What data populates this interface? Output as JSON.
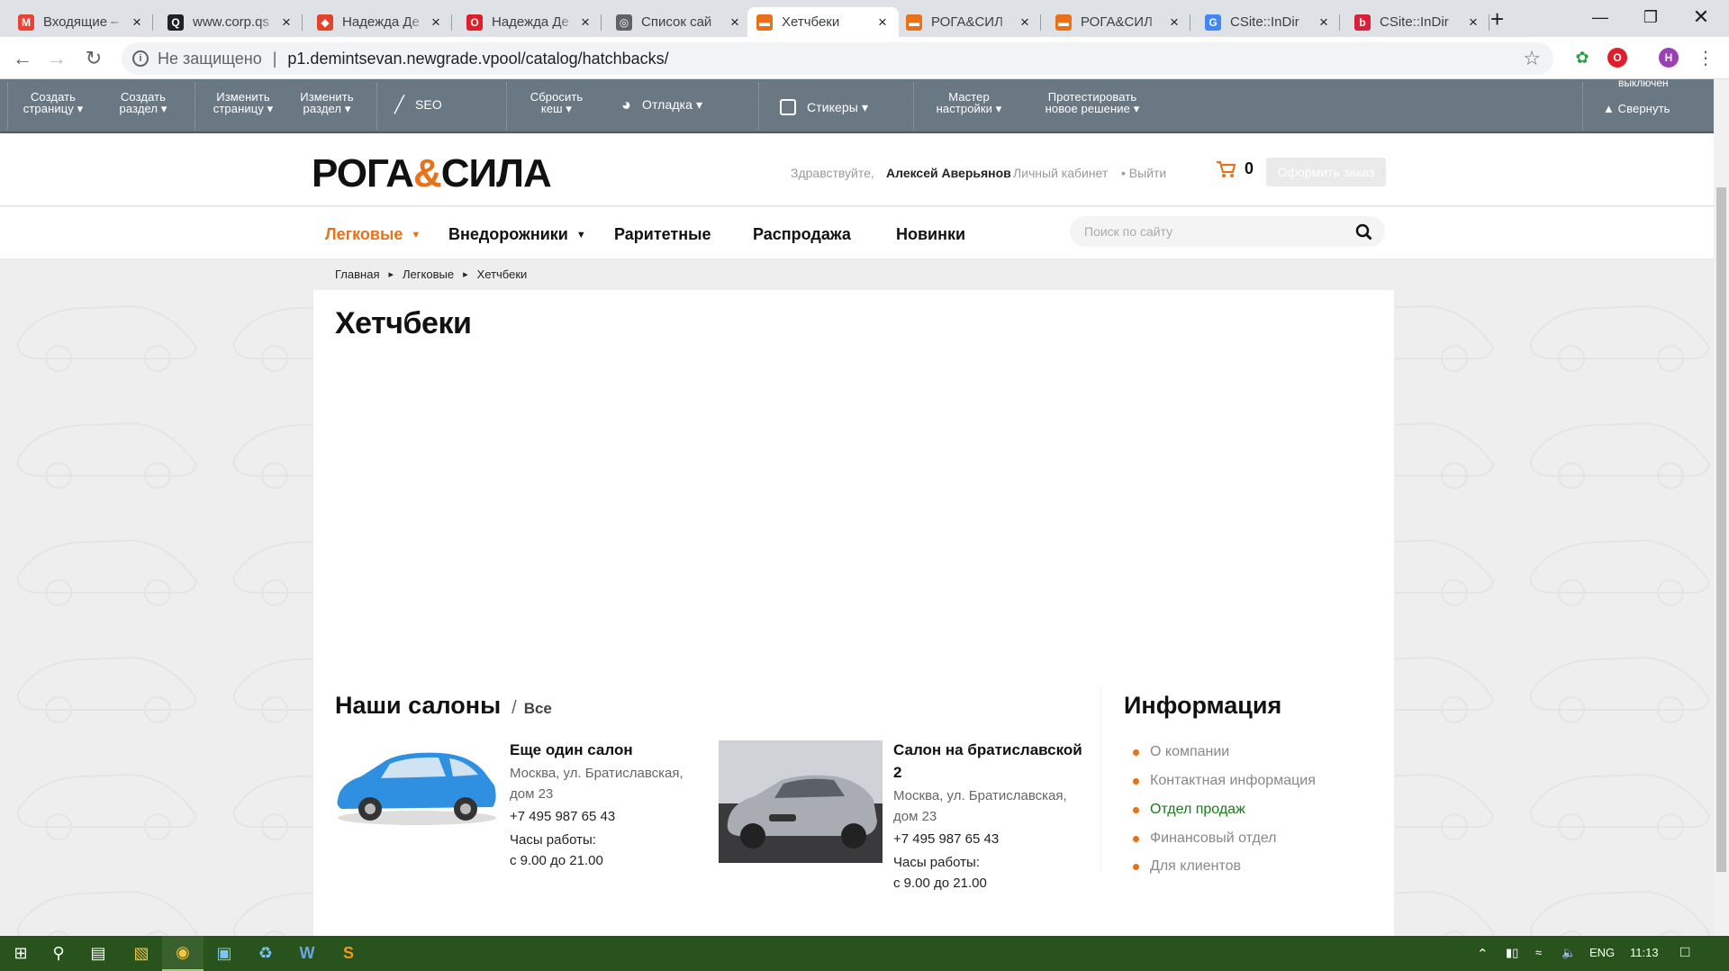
{
  "browser": {
    "tabs": [
      {
        "title": "Входящие – ",
        "favicon": "gmail-icon",
        "color": "#ea4335",
        "glyph": "M",
        "active": false
      },
      {
        "title": "www.corp.qs",
        "favicon": "quora-icon",
        "color": "#202124",
        "glyph": "Q",
        "active": false
      },
      {
        "title": "Надежда Де",
        "favicon": "gitlab-icon",
        "color": "#e24329",
        "glyph": "◆",
        "active": false
      },
      {
        "title": "Надежда Де",
        "favicon": "opera-icon",
        "color": "#e01e2b",
        "glyph": "O",
        "active": false
      },
      {
        "title": "Список сай",
        "favicon": "globe-icon",
        "color": "#5f6368",
        "glyph": "◎",
        "active": false
      },
      {
        "title": "Хетчбеки",
        "favicon": "car-icon",
        "color": "#e8711a",
        "glyph": "▬",
        "active": true
      },
      {
        "title": "РОГА&СИЛ",
        "favicon": "car-icon",
        "color": "#e8711a",
        "glyph": "▬",
        "active": false
      },
      {
        "title": "РОГА&СИЛ",
        "favicon": "car-icon",
        "color": "#e8711a",
        "glyph": "▬",
        "active": false
      },
      {
        "title": "CSite::InDir",
        "favicon": "google-icon",
        "color": "#4285f4",
        "glyph": "G",
        "active": false
      },
      {
        "title": "CSite::InDir",
        "favicon": "bitrix-icon",
        "color": "#d8203a",
        "glyph": "b",
        "active": false
      }
    ],
    "not_secure": "Не защищено",
    "url": "p1.demintsevan.newgrade.vpool/catalog/hatchbacks/",
    "profile_letter": "Н"
  },
  "admin_panel": {
    "create_page": [
      "Создать",
      "страницу ▾"
    ],
    "create_section": [
      "Создать",
      "раздел ▾"
    ],
    "edit_page": [
      "Изменить",
      "страницу ▾"
    ],
    "edit_section": [
      "Изменить",
      "раздел ▾"
    ],
    "seo": "SEO",
    "reset_cache": [
      "Сбросить",
      "кеш ▾"
    ],
    "debug": "Отладка ▾",
    "stickers": "Стикеры ▾",
    "wizard": [
      "Мастер",
      "настройки ▾"
    ],
    "test_solution": [
      "Протестировать",
      "новое решение ▾"
    ],
    "disabled_label": "выключен",
    "collapse": "▲ Свернуть"
  },
  "site": {
    "logo": {
      "left": "РОГА",
      "amp": "&",
      "right": "СИЛА"
    },
    "greeting": "Здравствуйте,",
    "user_name": "Алексей Аверьянов",
    "cabinet": "Личный кабинет",
    "logout": "• Выйти",
    "cart_count": "0",
    "order_button": "Оформить заказ",
    "nav": [
      {
        "label": "Легковые",
        "dropdown": true,
        "active": true
      },
      {
        "label": "Внедорожники",
        "dropdown": true,
        "active": false
      },
      {
        "label": "Раритетные",
        "dropdown": false,
        "active": false
      },
      {
        "label": "Распродажа",
        "dropdown": false,
        "active": false
      },
      {
        "label": "Новинки",
        "dropdown": false,
        "active": false
      }
    ],
    "search_placeholder": "Поиск по сайту",
    "breadcrumbs": [
      "Главная",
      "Легковые",
      "Хетчбеки"
    ],
    "page_title": "Хетчбеки",
    "salons": {
      "title": "Наши салоны",
      "separator": "/",
      "all_link": "Все",
      "items": [
        {
          "name": "Еще один салон",
          "address": "Москва, ул. Братиславская, дом 23",
          "phone": "+7 495 987 65 43",
          "hours_label": "Часы работы:",
          "hours": "с 9.00 до 21.00",
          "car_color": "#2f8fe0"
        },
        {
          "name": "Салон на братиславской 2",
          "address": "Москва, ул. Братиславская, дом 23",
          "phone": "+7 495 987 65 43",
          "hours_label": "Часы работы:",
          "hours": "с 9.00 до 21.00",
          "car_color": "#a9adb3"
        }
      ]
    },
    "info": {
      "title": "Информация",
      "items": [
        {
          "label": "О компании",
          "active": false
        },
        {
          "label": "Контактная информация",
          "active": false
        },
        {
          "label": "Отдел продаж",
          "active": true
        },
        {
          "label": "Финансовый отдел",
          "active": false
        },
        {
          "label": "Для клиентов",
          "active": false
        }
      ]
    },
    "accent_color": "#e8711a"
  },
  "taskbar": {
    "lang": "ENG",
    "time": "11:13"
  }
}
